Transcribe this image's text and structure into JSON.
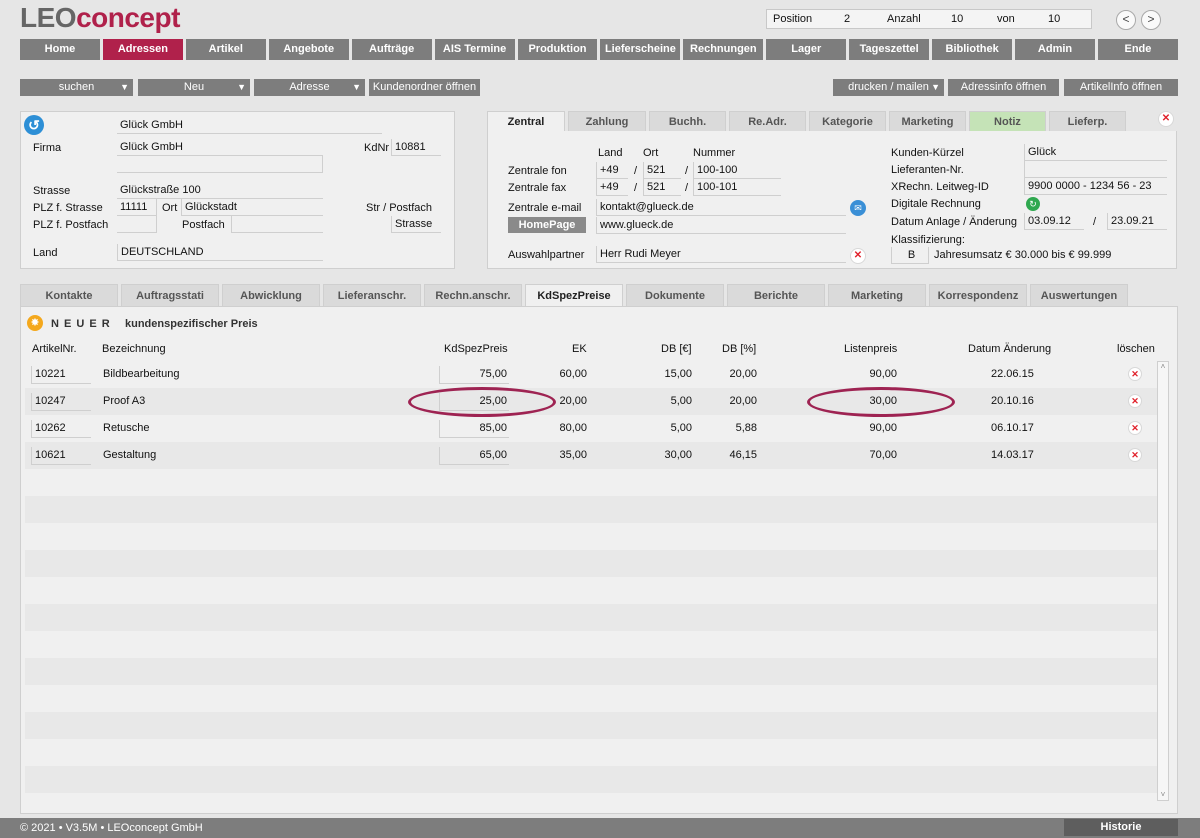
{
  "app": {
    "logo_leo": "LEO",
    "logo_concept": "concept"
  },
  "position": {
    "pos_label": "Position",
    "pos_value": "2",
    "anzahl_label": "Anzahl",
    "anzahl_value": "10",
    "von_label": "von",
    "von_value": "10",
    "prev": "<",
    "next": ">"
  },
  "nav": [
    "Home",
    "Adressen",
    "Artikel",
    "Angebote",
    "Aufträge",
    "AIS Termine",
    "Produktion",
    "Lieferscheine",
    "Rechnungen",
    "Lager",
    "Tageszettel",
    "Bibliothek",
    "Admin",
    "Ende"
  ],
  "nav_active": "Adressen",
  "toolbar": {
    "suchen": "suchen",
    "neu": "Neu",
    "adresse": "Adresse",
    "kundenordner": "Kundenordner öffnen",
    "drucken": "drucken / mailen",
    "adressinfo": "Adressinfo öffnen",
    "artikelinfo": "ArtikelInfo öffnen"
  },
  "address": {
    "name_top": "Glück GmbH",
    "firma_label": "Firma",
    "firma": "Glück GmbH",
    "kdnr_label": "KdNr",
    "kdnr": "10881",
    "strasse_label": "Strasse",
    "strasse": "Glückstraße 100",
    "plz_str_label": "PLZ f. Strasse",
    "plz": "11111",
    "ort_label": "Ort",
    "ort": "Glückstadt",
    "str_postfach_label": "Str / Postfach",
    "str_postfach_value": "Strasse",
    "plz_postfach_label": "PLZ f. Postfach",
    "postfach_label": "Postfach",
    "land_label": "Land",
    "land": "DEUTSCHLAND"
  },
  "right_tabs": [
    "Zentral",
    "Zahlung",
    "Buchh.",
    "Re.Adr.",
    "Kategorie",
    "Marketing",
    "Notiz",
    "Lieferp."
  ],
  "zentral": {
    "land_h": "Land",
    "ort_h": "Ort",
    "nummer_h": "Nummer",
    "fon_label": "Zentrale fon",
    "fon_land": "+49",
    "fon_ort": "521",
    "fon_nr": "100-100",
    "fax_label": "Zentrale fax",
    "fax_land": "+49",
    "fax_ort": "521",
    "fax_nr": "100-101",
    "sep": "/",
    "email_label": "Zentrale e-mail",
    "email": "kontakt@glueck.de",
    "homepage_btn": "HomePage",
    "homepage": "www.glueck.de",
    "partner_label": "Auswahlpartner",
    "partner": "Herr Rudi Meyer",
    "kuerzel_label": "Kunden-Kürzel",
    "kuerzel": "Glück",
    "lieferanten_label": "Lieferanten-Nr.",
    "lieferanten": "",
    "xrechn_label": "XRechn. Leitweg-ID",
    "xrechn": "9900 0000 - 1234 56 - 23",
    "digital_label": "Digitale Rechnung",
    "datum_label": "Datum Anlage / Änderung",
    "datum_anlage": "03.09.12",
    "datum_sep": "/",
    "datum_aenderung": "23.09.21",
    "klass_label": "Klassifizierung:",
    "klass_value": "B",
    "klass_text": "Jahresumsatz € 30.000 bis € 99.999"
  },
  "bottom_tabs": [
    "Kontakte",
    "Auftragsstati",
    "Abwicklung",
    "Lieferanschr.",
    "Rechn.anschr.",
    "KdSpezPreise",
    "Dokumente",
    "Berichte",
    "Marketing",
    "Korrespondenz",
    "Auswertungen"
  ],
  "bottom_active": "KdSpezPreise",
  "table": {
    "new_label_a": "N E U E R",
    "new_label_b": "kundenspezifischer Preis",
    "headers": {
      "artnr": "ArtikelNr.",
      "bez": "Bezeichnung",
      "kdspez": "KdSpezPreis",
      "ek": "EK",
      "db_eur": "DB [€]",
      "db_pct": "DB [%]",
      "listen": "Listenpreis",
      "datum": "Datum Änderung",
      "loeschen": "löschen"
    },
    "rows": [
      {
        "artnr": "10221",
        "bez": "Bildbearbeitung",
        "kdspez": "75,00",
        "ek": "60,00",
        "db_eur": "15,00",
        "db_pct": "20,00",
        "listen": "90,00",
        "datum": "22.06.15"
      },
      {
        "artnr": "10247",
        "bez": "Proof A3",
        "kdspez": "25,00",
        "ek": "20,00",
        "db_eur": "5,00",
        "db_pct": "20,00",
        "listen": "30,00",
        "datum": "20.10.16"
      },
      {
        "artnr": "10262",
        "bez": "Retusche",
        "kdspez": "85,00",
        "ek": "80,00",
        "db_eur": "5,00",
        "db_pct": "5,88",
        "listen": "90,00",
        "datum": "06.10.17"
      },
      {
        "artnr": "10621",
        "bez": "Gestaltung",
        "kdspez": "65,00",
        "ek": "35,00",
        "db_eur": "30,00",
        "db_pct": "46,15",
        "listen": "70,00",
        "datum": "14.03.17"
      }
    ]
  },
  "footer": {
    "copyright": "© 2021 • V3.5M • LEOconcept GmbH",
    "historie": "Historie"
  },
  "colors": {
    "accent": "#b0214b",
    "nav_gray": "#7d7d7d",
    "panel": "#f0f0f0",
    "notiz_green": "#c5e3b7"
  }
}
